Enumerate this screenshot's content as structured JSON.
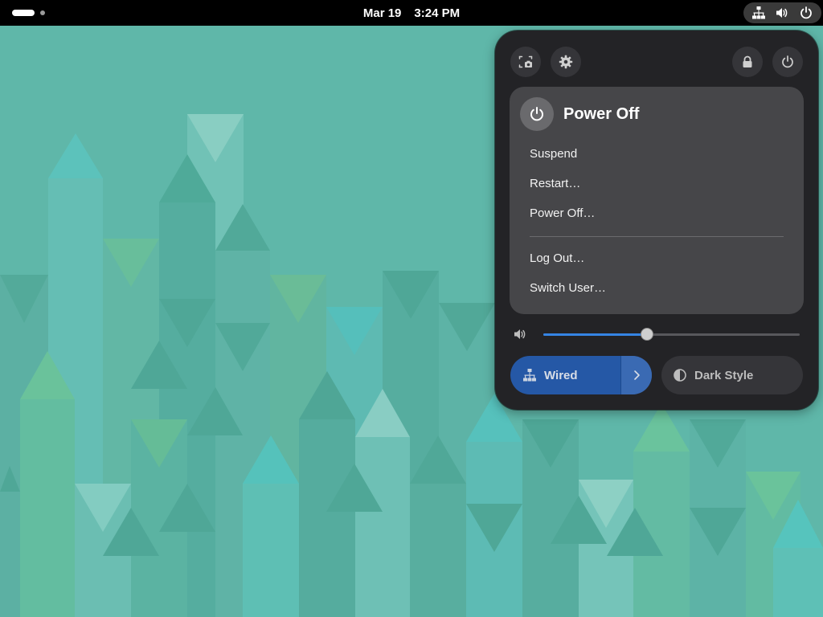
{
  "topbar": {
    "date": "Mar 19",
    "time": "3:24 PM",
    "status_icons": [
      "network-wired-icon",
      "volume-icon",
      "power-icon"
    ]
  },
  "quick_settings": {
    "buttons": [
      "screenshot-icon",
      "settings-icon",
      "lock-icon",
      "power-icon"
    ],
    "power_menu": {
      "title": "Power Off",
      "items": {
        "suspend": "Suspend",
        "restart": "Restart…",
        "power_off": "Power Off…",
        "log_out": "Log Out…",
        "switch_user": "Switch User…"
      }
    },
    "volume": {
      "icon": "volume-icon",
      "level": 0.405
    },
    "tiles": {
      "wired": {
        "label": "Wired",
        "active": true
      },
      "dark_style": {
        "label": "Dark Style",
        "active": false
      }
    }
  },
  "colors": {
    "accent": "#3584e4",
    "wired_tile": "#2558a6",
    "panel_bg": "#232326",
    "menu_bg": "#464649",
    "wallpaper_base": "#5fb7a9"
  }
}
